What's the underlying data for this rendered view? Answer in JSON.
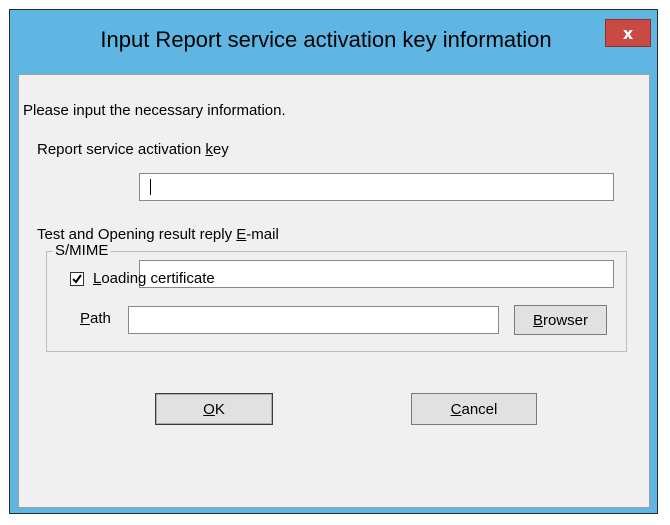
{
  "dialog": {
    "title": "Input Report service activation key information",
    "close_label": "x"
  },
  "form": {
    "instruction": "Please input the necessary information.",
    "activation_key": {
      "label_before": "Report service activation ",
      "label_mnemonic": "k",
      "label_after": "ey",
      "value": ""
    },
    "email": {
      "label_before": "Test and Opening result reply ",
      "label_mnemonic": "E",
      "label_after": "-mail",
      "value": ""
    }
  },
  "smime": {
    "legend": "S/MIME",
    "loading_certificate": {
      "label_mnemonic": "L",
      "label_after": "oading certificate",
      "checked": true
    },
    "path": {
      "label_mnemonic": "P",
      "label_after": "ath",
      "value": ""
    },
    "browser_button": {
      "label_mnemonic": "B",
      "label_after": "rowser"
    }
  },
  "buttons": {
    "ok": {
      "label_mnemonic": "O",
      "label_after": "K"
    },
    "cancel": {
      "label_mnemonic": "C",
      "label_after": "ancel"
    }
  }
}
